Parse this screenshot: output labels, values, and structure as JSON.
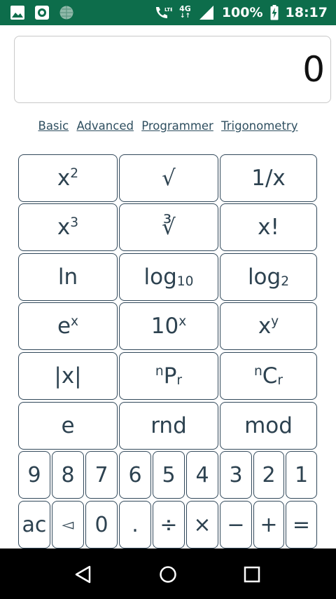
{
  "status_bar": {
    "network_top": "LTE",
    "network_label": "4G",
    "battery": "100%",
    "time": "18:17",
    "icons": [
      "image-icon",
      "target-icon",
      "globe-icon",
      "call-icon",
      "signal-icon",
      "battery-charging-icon"
    ]
  },
  "display": {
    "value": "0"
  },
  "modes": {
    "basic": "Basic",
    "advanced": "Advanced",
    "programmer": "Programmer",
    "trigonometry": "Trigonometry"
  },
  "keys": {
    "square_base": "x",
    "square_exp": "2",
    "sqrt": "√",
    "reciprocal": "1/x",
    "cube_base": "x",
    "cube_exp": "3",
    "cube_root": "∛",
    "factorial": "x!",
    "ln": "ln",
    "log10_base": "log",
    "log10_sub": "10",
    "log2_base": "log",
    "log2_sub": "2",
    "exp_base": "e",
    "exp_exp": "x",
    "pow10_base": "10",
    "pow10_exp": "x",
    "pow_base": "x",
    "pow_exp": "y",
    "abs": "|x|",
    "npr_pre": "n",
    "npr_main": "P",
    "npr_sub": "r",
    "ncr_pre": "n",
    "ncr_main": "C",
    "ncr_sub": "r",
    "e_const": "e",
    "rnd": "rnd",
    "mod": "mod",
    "digits_row": [
      "9",
      "8",
      "7",
      "6",
      "5",
      "4",
      "3",
      "2",
      "1"
    ],
    "ops_row": [
      "ac",
      "◅",
      "0",
      ".",
      "÷",
      "×",
      "−",
      "+",
      "="
    ]
  },
  "colors": {
    "status_bar": "#0d6d4b",
    "key_border": "#31485a",
    "key_text": "#2d4250",
    "mode_link": "#2f4f60"
  }
}
